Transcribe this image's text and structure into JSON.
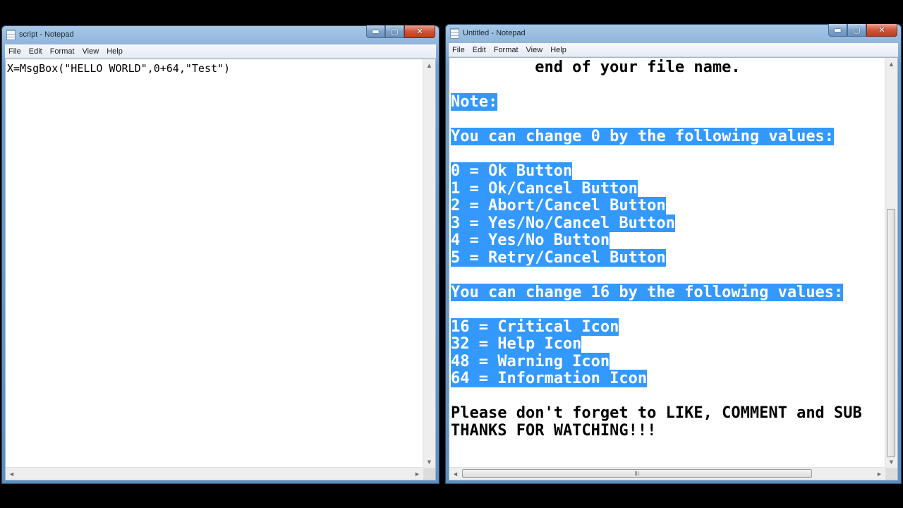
{
  "left_window": {
    "title": "script - Notepad",
    "menu": [
      "File",
      "Edit",
      "Format",
      "View",
      "Help"
    ],
    "content": "X=MsgBox(\"HELLO WORLD\",0+64,\"Test\")"
  },
  "right_window": {
    "title": "Untitled - Notepad",
    "menu": [
      "File",
      "Edit",
      "Format",
      "View",
      "Help"
    ],
    "lines": [
      {
        "text": "         end of your file name.",
        "selected": false
      },
      {
        "text": "",
        "selected": false
      },
      {
        "text": "Note:",
        "selected": true
      },
      {
        "text": "",
        "selected": false
      },
      {
        "text": "You can change 0 by the following values:",
        "selected": true
      },
      {
        "text": "",
        "selected": false
      },
      {
        "text": "0 = Ok Button",
        "selected": true
      },
      {
        "text": "1 = Ok/Cancel Button",
        "selected": true
      },
      {
        "text": "2 = Abort/Cancel Button",
        "selected": true
      },
      {
        "text": "3 = Yes/No/Cancel Button",
        "selected": true
      },
      {
        "text": "4 = Yes/No Button",
        "selected": true
      },
      {
        "text": "5 = Retry/Cancel Button",
        "selected": true
      },
      {
        "text": "",
        "selected": false
      },
      {
        "text": "You can change 16 by the following values:",
        "selected": true
      },
      {
        "text": "",
        "selected": false
      },
      {
        "text": "16 = Critical Icon",
        "selected": true
      },
      {
        "text": "32 = Help Icon",
        "selected": true
      },
      {
        "text": "48 = Warning Icon",
        "selected": true
      },
      {
        "text": "64 = Information Icon",
        "selected": true
      },
      {
        "text": "",
        "selected": false
      },
      {
        "text": "Please don't forget to LIKE, COMMENT and SUB",
        "selected": false
      },
      {
        "text": "THANKS FOR WATCHING!!!",
        "selected": false
      }
    ]
  },
  "caption_buttons": {
    "minimize": "▬",
    "maximize": "▢",
    "close": "✕"
  },
  "icons": {
    "scroll_up": "▲",
    "scroll_down": "▼",
    "scroll_left": "◀",
    "scroll_right": "▶"
  },
  "colors": {
    "selection": "#3399ff",
    "editor_bg": "#ffffff"
  }
}
